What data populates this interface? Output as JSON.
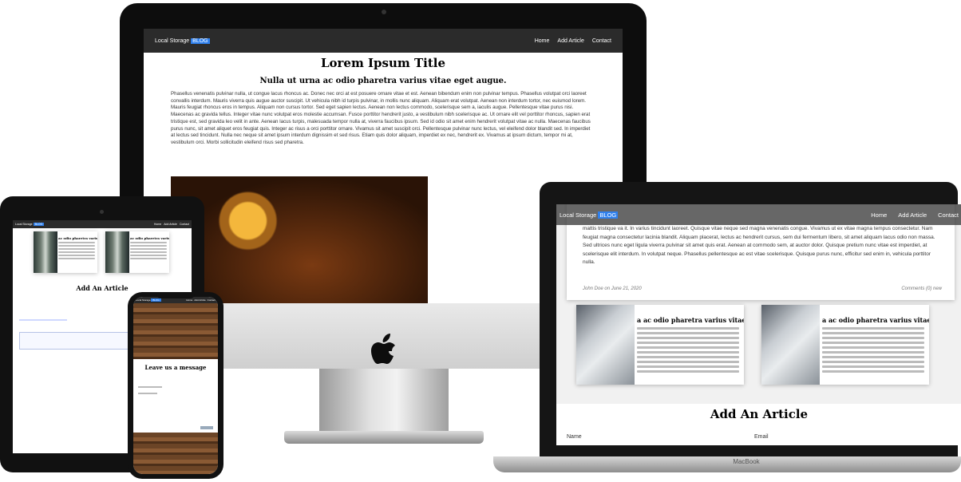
{
  "brand": {
    "name": "Local Storage",
    "tag": "BLOG"
  },
  "nav": {
    "home": "Home",
    "add": "Add Article",
    "contact": "Contact"
  },
  "article": {
    "title": "Lorem Ipsum Title",
    "subtitle": "Nulla ut urna ac odio pharetra varius vitae eget augue.",
    "body": "Phasellus venenatis pulvinar nulla, ut congue lacus rhoncus ac. Donec nec orci at est posuere ornare vitae et est. Aenean bibendum enim non pulvinar tempus. Phasellus volutpat orci laoreet convallis interdum. Mauris viverra quis augue auctor suscipit. Ut vehicula nibh id turpis pulvinar, in mollis nunc aliquam. Aliquam erat volutpat. Aenean non interdum tortor, nec euismod lorem. Mauris feugiat rhoncus eros in tempus. Aliquam non cursus tortor. Sed eget sapien lectus. Aenean non lectus commodo, scelerisque sem a, iaculis augue. Pellentesque vitae purus nisi. Maecenas ac gravida tellus. Integer vitae nunc volutpat eros molestie accumsan. Fusce porttitor hendrerit justo, a vestibulum nibh scelerisque ac. Ut ornare elit vel porttitor rhoncus, sapien erat tristique est, sed gravida leo velit in ante. Aenean lacus turpis, malesuada tempor nulla at, viverra faucibus ipsum. Sed id odio sit amet enim hendrerit volutpat vitae ac nulla. Maecenas faucibus purus nunc, sit amet aliquet eros feugiat quis. Integer ac risus a orci porttitor ornare. Vivamus sit amet suscipit orci. Pellentesque pulvinar nunc lectus, vel eleifend dolor blandit sed. In imperdiet at lectus sed tincidunt. Nulla nec neque sit amet ipsum interdum dignissim et sed risus. Etiam quis dolor aliquam, imperdiet ex nec, hendrerit ex. Vivamus at ipsum dictum, tempor mi at, vestibulum orci. Morbi sollicitudin eleifend risus sed pharetra."
  },
  "laptop": {
    "card_text": "mattis tristique va it. In varius tincidunt laoreet. Quisque vitae neque sed magna venenatis congue. Vivamus ut ex vitae magna tempus consectetur. Nam feugiat magna consectetur lacinia blandit. Aliquam placerat, lectus ac hendrerit cursus, sem dui fermentum libero, sit amet aliquam lacus odio non massa. Sed ultrices nunc eget ligula viverra pulvinar sit amet quis erat. Aenean at commodo sem, at auctor dolor. Quisque pretium nunc vitae est imperdiet, at scelerisque elit interdum. In volutpat neque. Phasellus pellentesque ac est vitae scelerisque. Quisque purus nunc, efficitur sed enim in, vehicula porttitor nulla.",
    "author": "John Doe on June 21, 2020",
    "comments": "Comments (0) new",
    "card_title": "a ac odio pharetra varius vitae e",
    "form_title": "Add An Article",
    "name_label": "Name",
    "email_label": "Email",
    "brand_model": "MacBook"
  },
  "tablet": {
    "form_title": "Add An Article",
    "card_title": "ac odio pharetra varius vitae"
  },
  "phone": {
    "form_title": "Leave us a message"
  },
  "colors": {
    "nav": "#2b2b2b",
    "accent": "#2f80ed"
  },
  "icons": {
    "apple": "apple-logo-icon"
  }
}
